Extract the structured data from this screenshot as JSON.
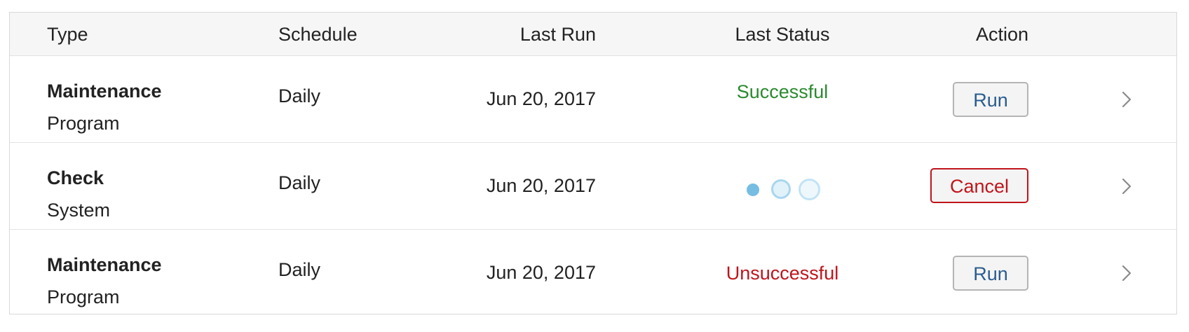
{
  "columns": {
    "type": "Type",
    "schedule": "Schedule",
    "last_run": "Last Run",
    "last_status": "Last Status",
    "action": "Action"
  },
  "rows": [
    {
      "type_title": "Maintenance",
      "type_sub": "Program",
      "schedule": "Daily",
      "last_run": "Jun 20, 2017",
      "status": "Successful",
      "status_kind": "success",
      "action": "Run"
    },
    {
      "type_title": "Check",
      "type_sub": "System",
      "schedule": "Daily",
      "last_run": "Jun 20, 2017",
      "status": "",
      "status_kind": "loading",
      "status_icon": "loading-dots-icon",
      "action": "Cancel"
    },
    {
      "type_title": "Maintenance",
      "type_sub": "Program",
      "schedule": "Daily",
      "last_run": "Jun 20, 2017",
      "status": "Unsuccessful",
      "status_kind": "fail",
      "action": "Run"
    }
  ],
  "colors": {
    "success": "#2b8a2f",
    "fail": "#c0141c",
    "run_button_text": "#2a5d8f",
    "cancel_button": "#c0141c",
    "header_bg": "#f6f6f6",
    "loader": "#76bde3"
  },
  "icons": {
    "row_chevron": "chevron-right-icon"
  }
}
